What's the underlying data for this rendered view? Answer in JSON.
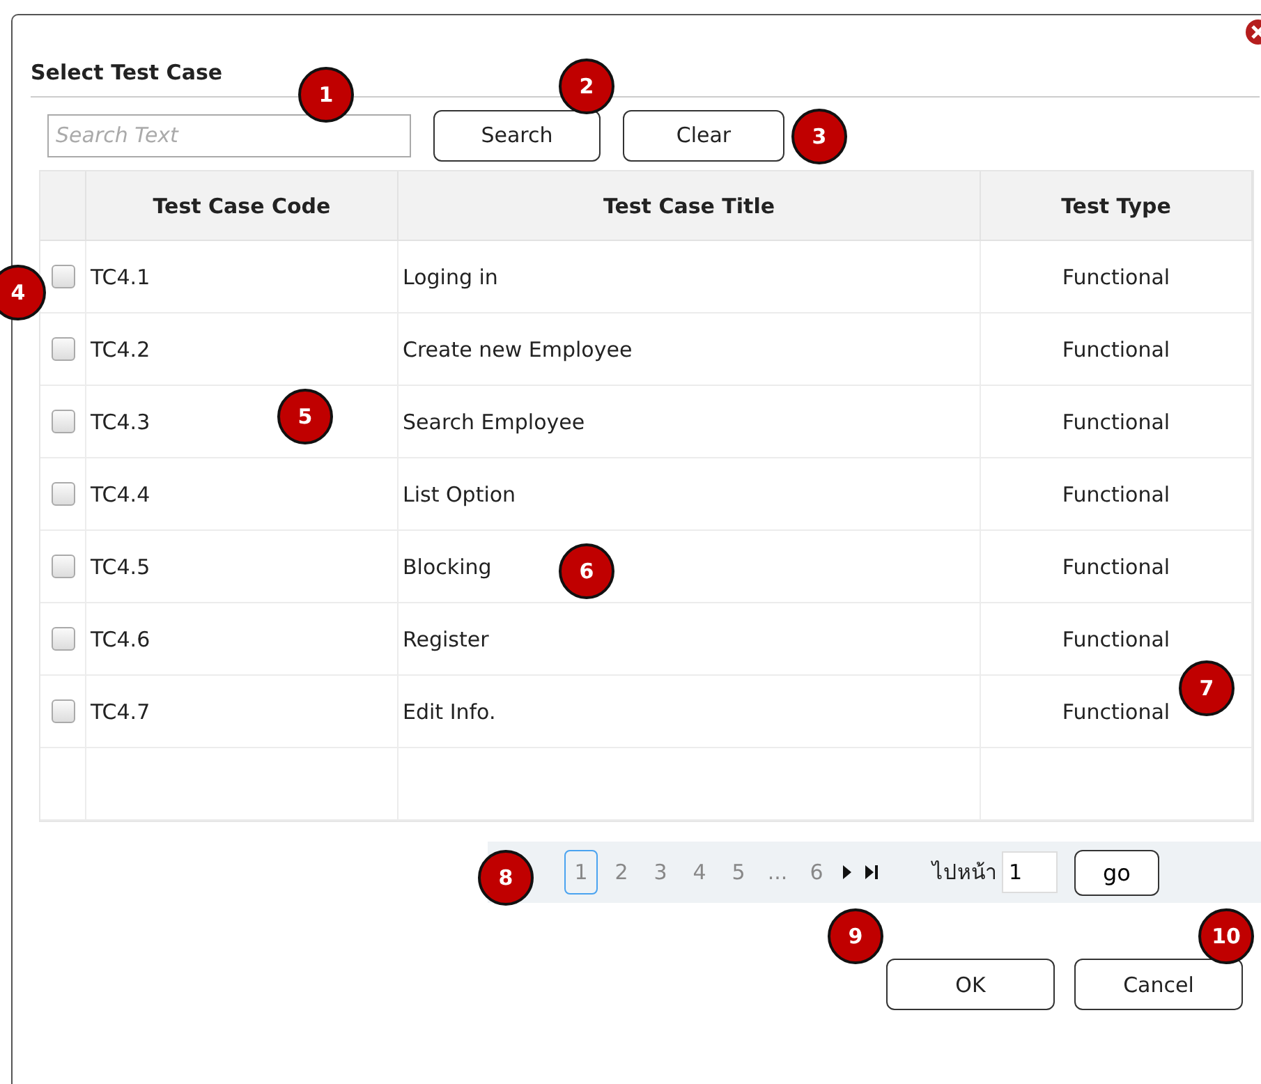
{
  "dialog": {
    "title": "Select Test Case"
  },
  "search": {
    "placeholder": "Search Text",
    "buttons": [
      "Search",
      "Clear"
    ]
  },
  "table": {
    "columns": [
      "Test Case Code",
      "Test Case Title",
      "Test Type"
    ],
    "rows": [
      {
        "checked": false,
        "code": "TC4.1",
        "title": "Loging in",
        "type": "Functional"
      },
      {
        "checked": false,
        "code": "TC4.2",
        "title": "Create new Employee",
        "type": "Functional"
      },
      {
        "checked": false,
        "code": "TC4.3",
        "title": "Search Employee",
        "type": "Functional"
      },
      {
        "checked": false,
        "code": "TC4.4",
        "title": "List Option",
        "type": "Functional"
      },
      {
        "checked": false,
        "code": "TC4.5",
        "title": "Blocking",
        "type": "Functional"
      },
      {
        "checked": false,
        "code": "TC4.6",
        "title": "Register",
        "type": "Functional"
      },
      {
        "checked": false,
        "code": "TC4.7",
        "title": "Edit Info.",
        "type": "Functional"
      }
    ]
  },
  "pager": {
    "pages": [
      {
        "label": "1",
        "selected": true
      },
      {
        "label": "2",
        "selected": false
      },
      {
        "label": "3",
        "selected": false
      },
      {
        "label": "4",
        "selected": false
      },
      {
        "label": "5",
        "selected": false
      },
      {
        "label": "...",
        "selected": false
      },
      {
        "label": "6",
        "selected": false
      }
    ],
    "goto_label": "ไปหน้า",
    "goto_value": "1",
    "go_button": "go"
  },
  "buttons": [
    "OK",
    "Cancel"
  ],
  "markers": [
    {
      "label": "1"
    },
    {
      "label": "2"
    },
    {
      "label": "3"
    },
    {
      "label": "4"
    },
    {
      "label": "5"
    },
    {
      "label": "6"
    },
    {
      "label": "7"
    },
    {
      "label": "8"
    },
    {
      "label": "9"
    },
    {
      "label": "10"
    }
  ]
}
